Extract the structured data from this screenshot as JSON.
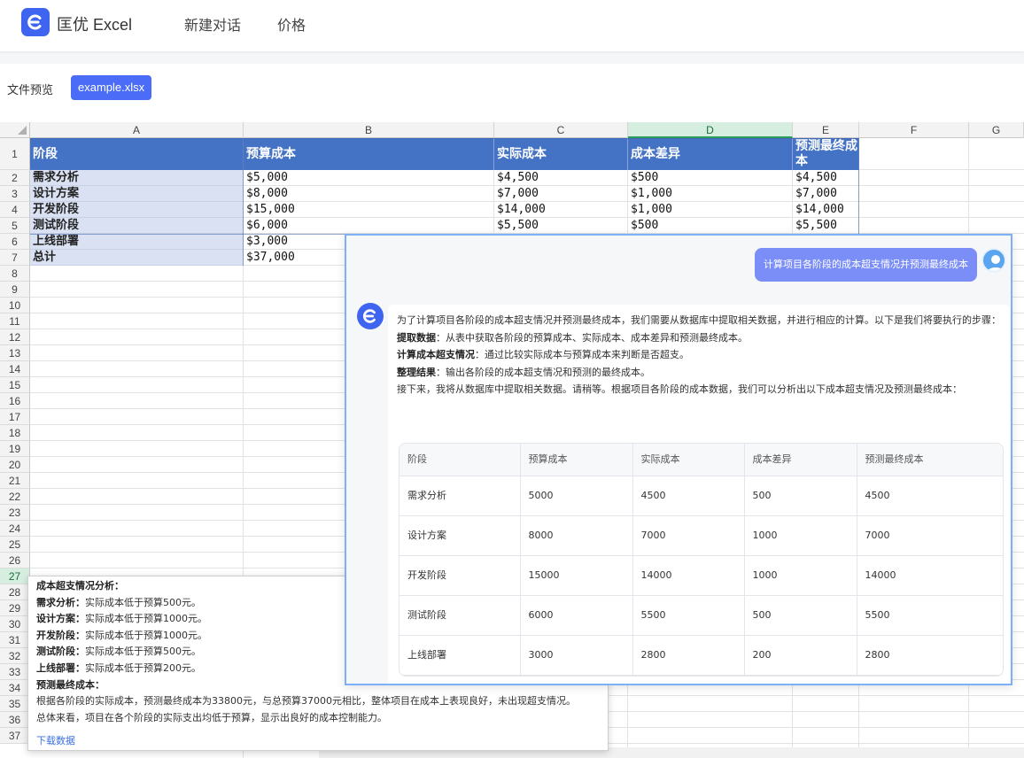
{
  "app": {
    "brand": "匡优 Excel",
    "nav": [
      "新建对话",
      "价格"
    ]
  },
  "preview": {
    "label": "文件预览",
    "file": "example.xlsx"
  },
  "sheet": {
    "columns": [
      "A",
      "B",
      "C",
      "D",
      "E",
      "F",
      "G"
    ],
    "selected_column": "D",
    "selected_row": "27",
    "rows": [
      "1",
      "2",
      "3",
      "4",
      "5",
      "6",
      "7",
      "8",
      "9",
      "10",
      "11",
      "12",
      "13",
      "14",
      "15",
      "16",
      "17",
      "18",
      "19",
      "20",
      "21",
      "22",
      "23",
      "24",
      "25",
      "26",
      "27",
      "28",
      "29",
      "30",
      "31",
      "32",
      "33",
      "34",
      "35",
      "36",
      "37"
    ],
    "headers": [
      "阶段",
      "预算成本",
      "实际成本",
      "成本差异",
      "预测最终成本"
    ],
    "data": [
      [
        "需求分析",
        "$5,000",
        "$4,500",
        "$500",
        "$4,500"
      ],
      [
        "设计方案",
        "$8,000",
        "$7,000",
        "$1,000",
        "$7,000"
      ],
      [
        "开发阶段",
        "$15,000",
        "$14,000",
        "$1,000",
        "$14,000"
      ],
      [
        "测试阶段",
        "$6,000",
        "$5,500",
        "$500",
        "$5,500"
      ],
      [
        "上线部署",
        "$3,000",
        "",
        "",
        ""
      ],
      [
        "总计",
        "$37,000",
        "",
        "",
        ""
      ]
    ]
  },
  "chat": {
    "user_message": "计算项目各阶段的成本超支情况并预测最终成本",
    "intro": "为了计算项目各阶段的成本超支情况并预测最终成本，我们需要从数据库中提取相关数据，并进行相应的计算。以下是我们将要执行的步骤：",
    "steps": [
      {
        "title": "提取数据",
        "text": "：从表中获取各阶段的预算成本、实际成本、成本差异和预测最终成本。"
      },
      {
        "title": "计算成本超支情况",
        "text": "：通过比较实际成本与预算成本来判断是否超支。"
      },
      {
        "title": "整理结果",
        "text": "：输出各阶段的成本超支情况和预测的最终成本。"
      }
    ],
    "followup": "接下来，我将从数据库中提取相关数据。请稍等。根据项目各阶段的成本数据，我们可以分析出以下成本超支情况及预测最终成本：",
    "table_headers": [
      "阶段",
      "预算成本",
      "实际成本",
      "成本差异",
      "预测最终成本"
    ],
    "table_rows": [
      [
        "需求分析",
        "5000",
        "4500",
        "500",
        "4500"
      ],
      [
        "设计方案",
        "8000",
        "7000",
        "1000",
        "7000"
      ],
      [
        "开发阶段",
        "15000",
        "14000",
        "1000",
        "14000"
      ],
      [
        "测试阶段",
        "6000",
        "5500",
        "500",
        "5500"
      ],
      [
        "上线部署",
        "3000",
        "2800",
        "200",
        "2800"
      ]
    ]
  },
  "analysis": {
    "heading": "成本超支情况分析：",
    "items": [
      {
        "title": "需求分析：",
        "text": "实际成本低于预算500元。"
      },
      {
        "title": "设计方案：",
        "text": "实际成本低于预算1000元。"
      },
      {
        "title": "开发阶段：",
        "text": "实际成本低于预算1000元。"
      },
      {
        "title": "测试阶段：",
        "text": "实际成本低于预算500元。"
      },
      {
        "title": "上线部署：",
        "text": "实际成本低于预算200元。"
      }
    ],
    "forecast_heading": "预测最终成本：",
    "forecast_text": "根据各阶段的实际成本，预测最终成本为33800元，与总预算37000元相比，整体项目在成本上表现良好，未出现超支情况。",
    "summary": "总体来看，项目在各个阶段的实际支出均低于预算，显示出良好的成本控制能力。",
    "download": "下载数据"
  }
}
